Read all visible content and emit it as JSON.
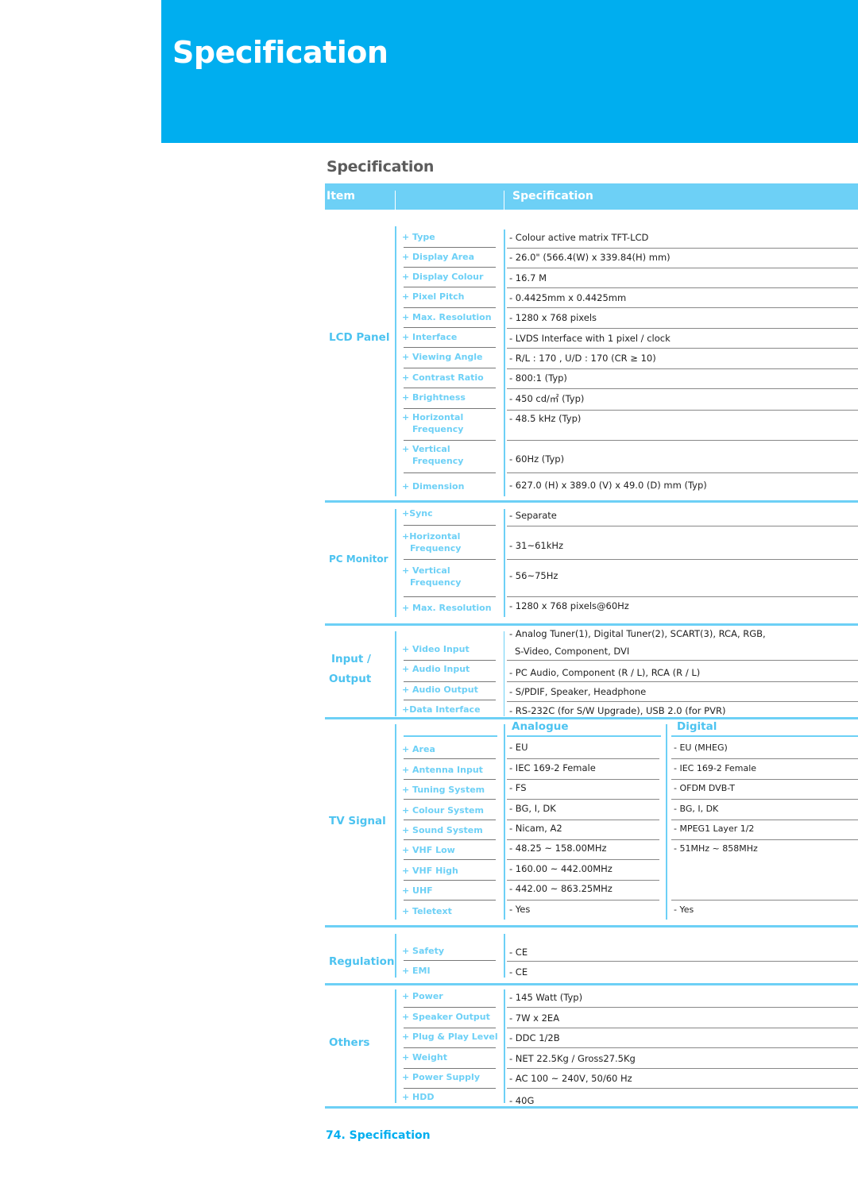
{
  "banner": {
    "title": "Specification"
  },
  "section_title": "Specification",
  "table_header": {
    "item": "Item",
    "spec": "Specification"
  },
  "groups": {
    "lcd": {
      "name": "LCD Panel",
      "rows": [
        {
          "label": "+ Type",
          "value": "- Colour active matrix TFT-LCD"
        },
        {
          "label": "+ Display Area",
          "value": "- 26.0\" (566.4(W) x 339.84(H) mm)"
        },
        {
          "label": "+ Display Colour",
          "value": "- 16.7 M"
        },
        {
          "label": "+ Pixel Pitch",
          "value": "- 0.4425mm x 0.4425mm"
        },
        {
          "label": "+ Max. Resolution",
          "value": "- 1280 x 768 pixels"
        },
        {
          "label": "+ Interface",
          "value": "- LVDS Interface with 1 pixel / clock"
        },
        {
          "label": "+ Viewing Angle",
          "value": "- R/L : 170 , U/D : 170 (CR ≥ 10)"
        },
        {
          "label": "+ Contrast Ratio",
          "value": "- 800:1 (Typ)"
        },
        {
          "label": "+ Brightness",
          "value": "- 450 cd/㎡  (Typ)"
        },
        {
          "label": "+ Horizontal",
          "label2": "Frequency",
          "value": "- 48.5 kHz (Typ)"
        },
        {
          "label": "+ Vertical",
          "label2": "Frequency",
          "value": "- 60Hz (Typ)"
        },
        {
          "label": "+ Dimension",
          "value": "- 627.0 (H) x 389.0 (V) x 49.0 (D) mm (Typ)"
        }
      ]
    },
    "pc": {
      "name": "PC Monitor",
      "rows": [
        {
          "label": "+Sync",
          "value": "- Separate"
        },
        {
          "label": "+Horizontal",
          "label2": "Frequency",
          "value": "- 31~61kHz"
        },
        {
          "label": "+ Vertical",
          "label2": "Frequency",
          "value": "- 56~75Hz"
        },
        {
          "label": "+ Max. Resolution",
          "value": "- 1280 x 768 pixels@60Hz"
        }
      ]
    },
    "io": {
      "name1": "Input /",
      "name2": "Output",
      "rows": [
        {
          "label": "+ Video Input",
          "value": "- Analog Tuner(1), Digital Tuner(2), SCART(3), RCA, RGB,",
          "value2": "S-Video, Component, DVI"
        },
        {
          "label": "+ Audio Input",
          "value": "- PC Audio, Component (R / L), RCA (R / L)"
        },
        {
          "label": "+ Audio Output",
          "value": "- S/PDIF, Speaker, Headphone"
        },
        {
          "label": "+Data Interface",
          "value": "- RS-232C (for S/W Upgrade), USB 2.0 (for PVR)"
        }
      ]
    },
    "tv": {
      "name": "TV Signal",
      "col_analogue": "Analogue",
      "col_digital": "Digital",
      "rows": [
        {
          "label": "+ Area",
          "analogue": "- EU",
          "digital": "- EU (MHEG)"
        },
        {
          "label": "+ Antenna Input",
          "analogue": "- IEC 169-2 Female",
          "digital": "- IEC 169-2 Female"
        },
        {
          "label": "+ Tuning System",
          "analogue": "- FS",
          "digital": "- OFDM DVB-T"
        },
        {
          "label": "+ Colour System",
          "analogue": "- BG, I, DK",
          "digital": "- BG, I, DK"
        },
        {
          "label": "+ Sound System",
          "analogue": "- Nicam, A2",
          "digital": "- MPEG1  Layer 1/2"
        },
        {
          "label": "+ VHF Low",
          "analogue": "- 48.25 ~ 158.00MHz",
          "digital": "- 51MHz ~ 858MHz"
        },
        {
          "label": "+ VHF High",
          "analogue": "- 160.00 ~ 442.00MHz",
          "digital": ""
        },
        {
          "label": "+ UHF",
          "analogue": "- 442.00 ~ 863.25MHz",
          "digital": ""
        },
        {
          "label": "+ Teletext",
          "analogue": "- Yes",
          "digital": "- Yes"
        }
      ]
    },
    "reg": {
      "name": "Regulation",
      "rows": [
        {
          "label": "+ Safety",
          "value": "- CE"
        },
        {
          "label": "+ EMI",
          "value": "- CE"
        }
      ]
    },
    "others": {
      "name": "Others",
      "rows": [
        {
          "label": "+ Power",
          "value": "- 145 Watt (Typ)"
        },
        {
          "label": "+ Speaker Output",
          "value": "- 7W x 2EA"
        },
        {
          "label": "+ Plug & Play Level",
          "value": "- DDC 1/2B"
        },
        {
          "label": "+ Weight",
          "value": "- NET 22.5Kg / Gross27.5Kg"
        },
        {
          "label": "+ Power Supply",
          "value": "- AC 100 ~ 240V,  50/60 Hz"
        },
        {
          "label": "+ HDD",
          "value": "- 40G"
        }
      ]
    }
  },
  "footer": "74. Specification",
  "colors": {
    "brand": "#00aeef",
    "accent_light": "#6dd0f6",
    "category_text": "#4dc3f0"
  }
}
